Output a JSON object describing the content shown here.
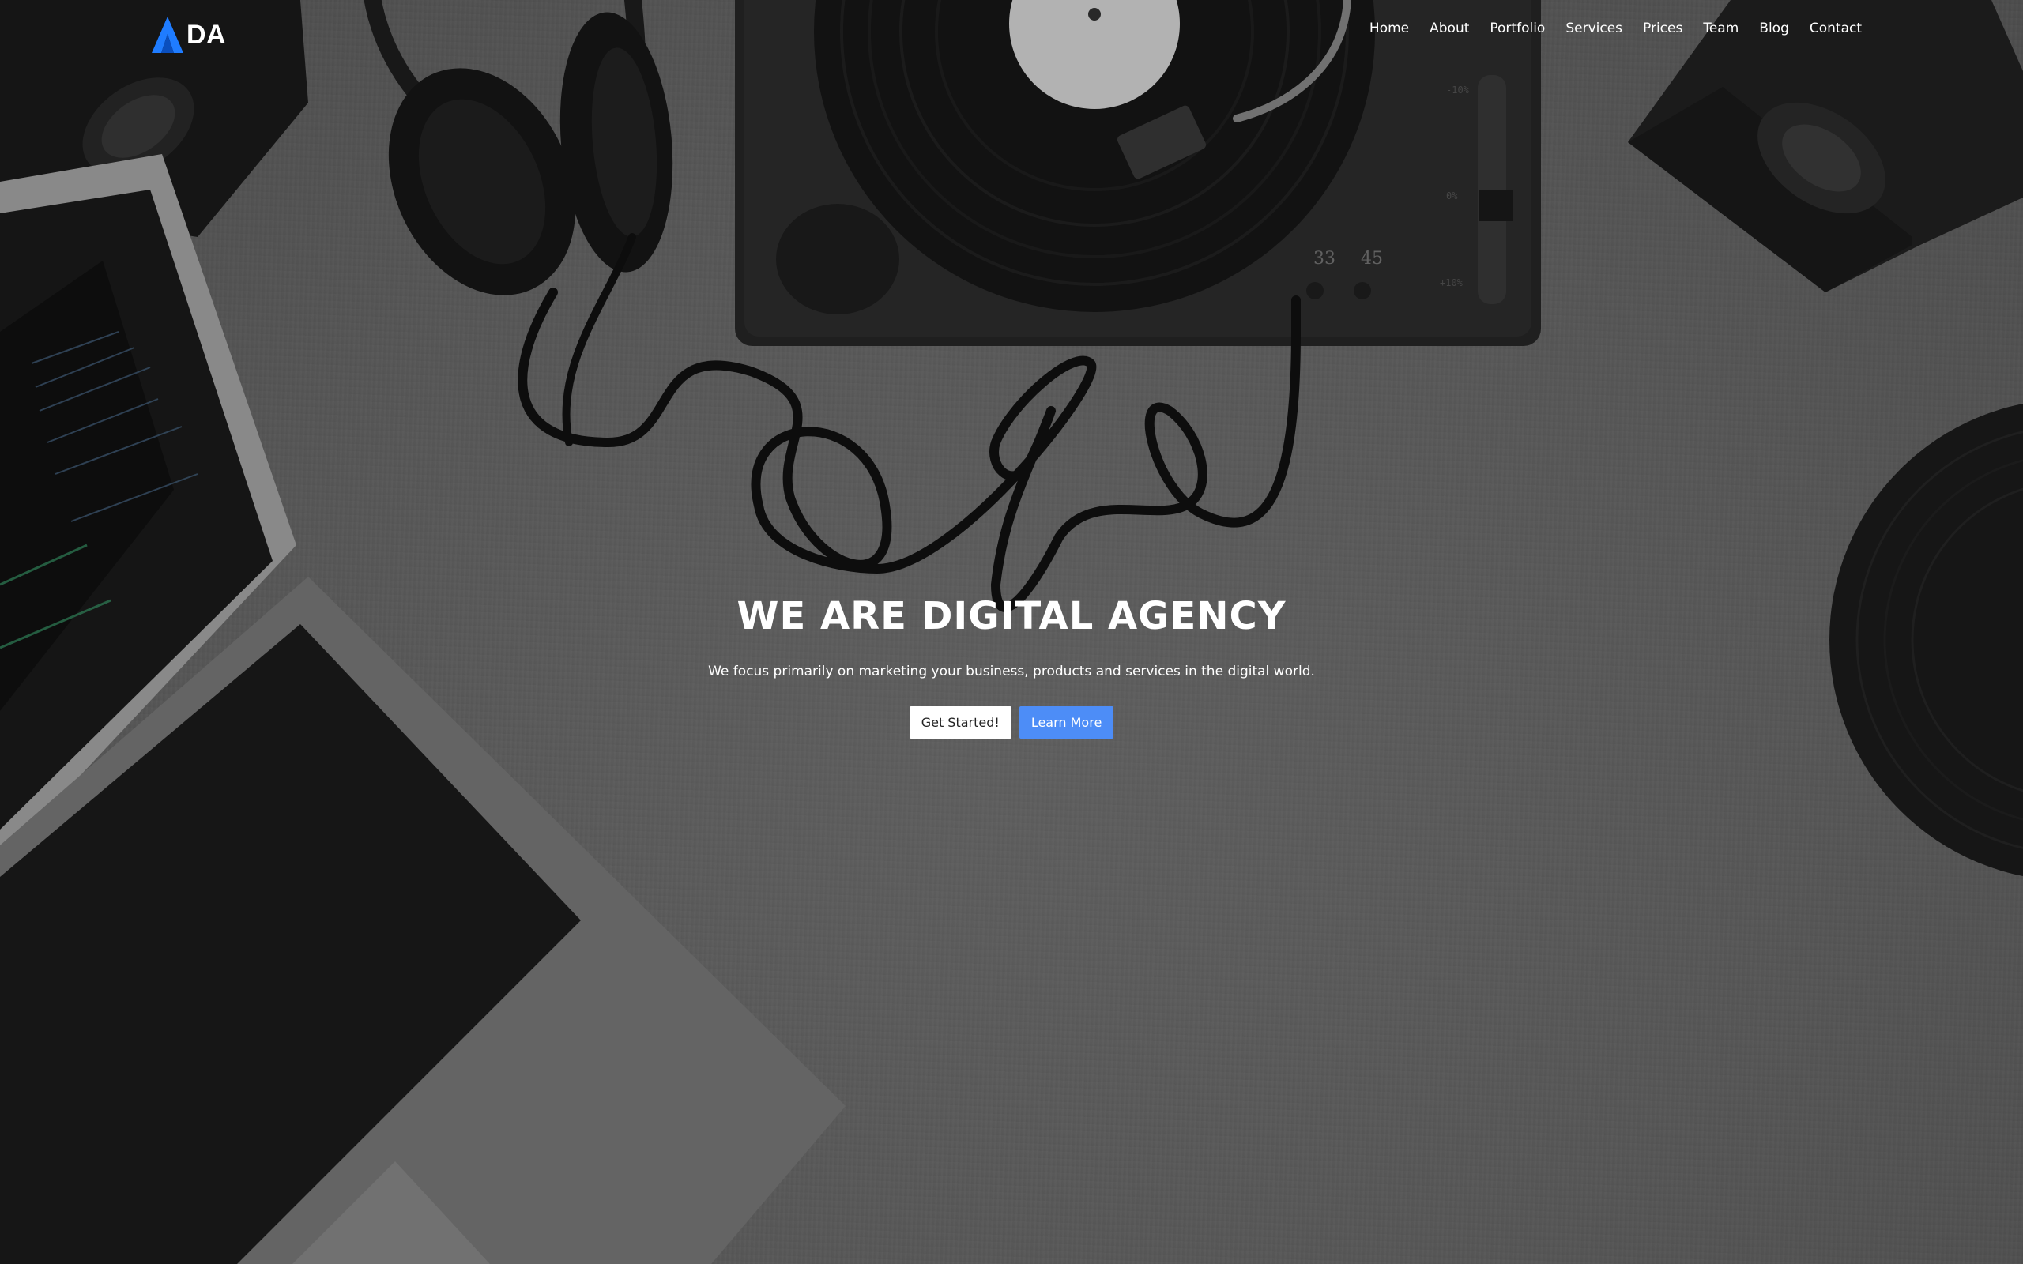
{
  "brand": {
    "text": "DA",
    "icon": "triangle-logo-icon",
    "accent": "#1f7cff"
  },
  "nav": {
    "items": [
      {
        "label": "Home"
      },
      {
        "label": "About"
      },
      {
        "label": "Portfolio"
      },
      {
        "label": "Services"
      },
      {
        "label": "Prices"
      },
      {
        "label": "Team"
      },
      {
        "label": "Blog"
      },
      {
        "label": "Contact"
      }
    ]
  },
  "hero": {
    "title": "WE ARE DIGITAL AGENCY",
    "subtitle": "We focus primarily on marketing your business, products and services in the digital world.",
    "primary_button": "Get Started!",
    "secondary_button": "Learn More",
    "secondary_color": "#4d8df7",
    "turntable_speeds": [
      "33",
      "45"
    ]
  }
}
